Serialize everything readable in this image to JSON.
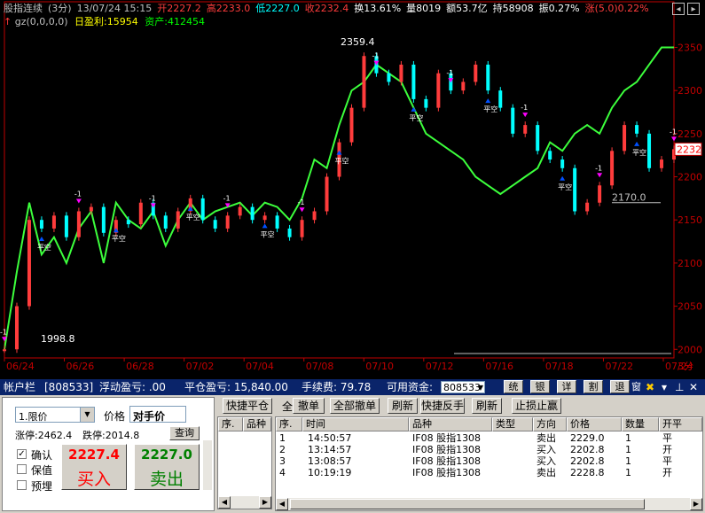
{
  "quote_header": {
    "symbol": "股指连续",
    "period": "(3分)",
    "datetime": "13/07/24 15:15",
    "open": "开2227.2",
    "high": "高2233.0",
    "low": "低2227.0",
    "close": "收2232.4",
    "turnover": "换13.61%",
    "volume": "量8019",
    "amount": "额53.7亿",
    "position": "持58908",
    "amplitude": "振0.27%",
    "change": "涨(5.0)0.22%"
  },
  "indicator_bar": {
    "formula": "gz(0,0,0,0)",
    "daily_profit": "日盈利:15954",
    "assets": "资产:412454"
  },
  "colors": {
    "up": "#ff3c3c",
    "down": "#00ffff",
    "equity_line": "#3cff3c",
    "axis": "#c00000",
    "text_gray": "#c0c0c0"
  },
  "chart_data": {
    "type": "line",
    "y_ticks": [
      "2350",
      "2300",
      "2250",
      "2200",
      "2150",
      "2100",
      "2050",
      "2000"
    ],
    "x_ticks": [
      "06/24",
      "06/26",
      "06/28",
      "07/02",
      "07/04",
      "07/08",
      "07/10",
      "07/12",
      "07/16",
      "07/18",
      "07/22",
      "07/24"
    ],
    "x_unit": "3分",
    "current_price_label": "2232",
    "annotations": {
      "high": "2359.4",
      "low": "1998.8",
      "mark": "2170.0"
    },
    "trade_marks": [
      "-1",
      "平多",
      "开空",
      "平空",
      "开多",
      "1"
    ],
    "ylim": [
      1990,
      2370
    ],
    "price": [
      2000,
      2050,
      2150,
      2140,
      2155,
      2130,
      2160,
      2165,
      2135,
      2150,
      2145,
      2170,
      2155,
      2140,
      2160,
      2175,
      2150,
      2140,
      2155,
      2165,
      2150,
      2155,
      2140,
      2130,
      2150,
      2160,
      2200,
      2240,
      2280,
      2340,
      2320,
      2310,
      2330,
      2290,
      2280,
      2320,
      2300,
      2310,
      2330,
      2300,
      2280,
      2250,
      2260,
      2230,
      2220,
      2210,
      2160,
      2170,
      2190,
      2230,
      2260,
      2250,
      2210,
      2220,
      2232
    ],
    "equity": [
      2000,
      2090,
      2170,
      2110,
      2130,
      2100,
      2140,
      2160,
      2100,
      2170,
      2150,
      2140,
      2160,
      2120,
      2150,
      2170,
      2150,
      2160,
      2165,
      2170,
      2155,
      2170,
      2165,
      2150,
      2175,
      2220,
      2210,
      2260,
      2300,
      2310,
      2330,
      2320,
      2310,
      2280,
      2250,
      2240,
      2230,
      2220,
      2200,
      2190,
      2180,
      2190,
      2200,
      2210,
      2240,
      2230,
      2250,
      2260,
      2250,
      2280,
      2300,
      2310,
      2330,
      2350,
      2350
    ]
  },
  "account_bar": {
    "title": "帐户栏",
    "account": "[808533]",
    "float_pnl": "浮动盈亏: .00",
    "close_pnl": "平仓盈亏: 15,840.00",
    "fee": "手续费: 79.78",
    "available": "可用资金:",
    "fund_select": "808533",
    "btns": [
      "统",
      "银",
      "详",
      "割",
      "退",
      "窗"
    ],
    "window_icons": [
      "✖",
      "▾",
      "⊥",
      "✕"
    ]
  },
  "order_panel": {
    "order_type": "1.限价",
    "price_label": "价格",
    "price_value": "对手价",
    "limit_up": "涨停:2462.4",
    "limit_down": "跌停:2014.8",
    "query": "查询",
    "confirm": "确认",
    "hedge": "保值",
    "preload": "预埋",
    "buy_price": "2227.4",
    "buy_label": "买入",
    "sell_price": "2227.0",
    "sell_label": "卖出"
  },
  "positions_panel": {
    "quick_close": "快捷平仓",
    "next_btn": "全",
    "headers": [
      "序.",
      "品种"
    ]
  },
  "orders_panel": {
    "buttons": [
      "撤单",
      "全部撤单",
      "刷新",
      "快捷反手",
      "刷新",
      "止损止赢"
    ],
    "headers": [
      "序.",
      "时间",
      "品种",
      "类型",
      "方向",
      "价格",
      "数量",
      "开平"
    ],
    "rows": [
      [
        "1",
        "14:50:57",
        "IF08 股指1308",
        "",
        "卖出",
        "2229.0",
        "1",
        "平"
      ],
      [
        "2",
        "13:14:57",
        "IF08 股指1308",
        "",
        "买入",
        "2202.8",
        "1",
        "开"
      ],
      [
        "3",
        "13:08:57",
        "IF08 股指1308",
        "",
        "买入",
        "2202.8",
        "1",
        "平"
      ],
      [
        "4",
        "10:19:19",
        "IF08 股指1308",
        "",
        "卖出",
        "2228.8",
        "1",
        "开"
      ]
    ]
  }
}
